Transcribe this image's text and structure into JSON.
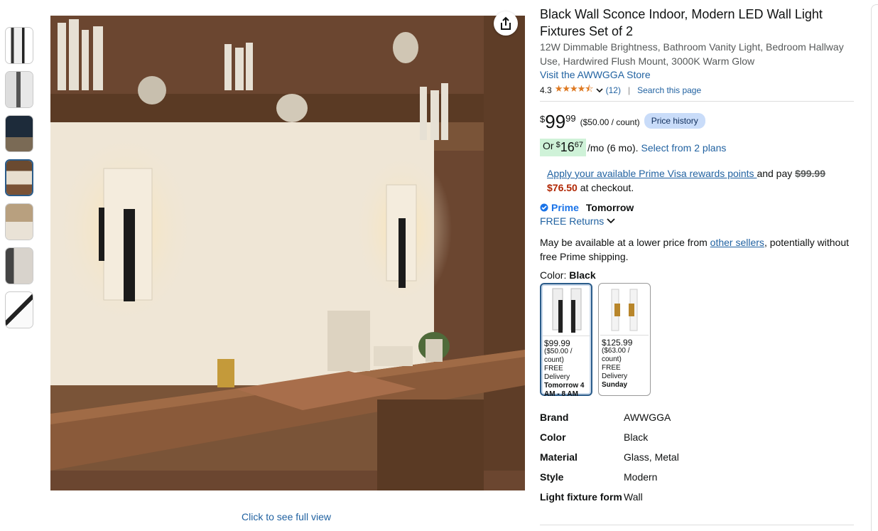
{
  "image": {
    "full_view_label": "Click to see full view"
  },
  "thumbnails": [
    {
      "name": "thumb-1"
    },
    {
      "name": "thumb-2"
    },
    {
      "name": "thumb-3"
    },
    {
      "name": "thumb-4"
    },
    {
      "name": "thumb-5"
    },
    {
      "name": "thumb-6"
    },
    {
      "name": "thumb-7"
    }
  ],
  "product": {
    "title": "Black Wall Sconce Indoor, Modern LED Wall Light Fixtures Set of 2",
    "subtitle": "12W Dimmable Brightness, Bathroom Vanity Light, Bedroom Hallway Use, Hardwired Flush Mount, 3000K Warm Glow",
    "store_link": "Visit the AWWGGA Store",
    "rating_value": "4.3",
    "stars": "★★★★⯪",
    "rating_count": "(12)",
    "search_page": "Search this page"
  },
  "price": {
    "symbol": "$",
    "whole": "99",
    "fraction": "99",
    "unit_price": "($50.00 / count)",
    "history_label": "Price history"
  },
  "monthly": {
    "prefix": "Or",
    "symbol": "$",
    "whole": "16",
    "fraction": "67",
    "suffix": "/mo (6 mo).",
    "plans_link": "Select from 2 plans"
  },
  "promo": {
    "link": "Apply your available Prime Visa rewards points ",
    "and_pay": "and pay",
    "old_price": "$99.99",
    "new_price": "$76.50",
    "checkout": "at checkout."
  },
  "delivery": {
    "prime_label": "Prime",
    "day": "Tomorrow",
    "returns": "FREE Returns"
  },
  "availability": {
    "text_1": "May be available at a lower price from ",
    "link": "other sellers",
    "text_2": ", potentially without free Prime shipping."
  },
  "color": {
    "label": "Color:",
    "value": "Black"
  },
  "swatches": [
    {
      "price": "$99.99",
      "unit": "($50.00 / count)",
      "delivery": "FREE Delivery",
      "when": "Tomorrow 4 AM - 8 AM",
      "selected": true
    },
    {
      "price": "$125.99",
      "unit": "($63.00 / count)",
      "delivery": "FREE Delivery",
      "when": "Sunday",
      "selected": false
    }
  ],
  "specs": [
    {
      "k": "Brand",
      "v": "AWWGGA"
    },
    {
      "k": "Color",
      "v": "Black"
    },
    {
      "k": "Material",
      "v": "Glass, Metal"
    },
    {
      "k": "Style",
      "v": "Modern"
    },
    {
      "k": "Light fixture form",
      "v": "Wall"
    }
  ],
  "colors": {
    "link": "#2162a1",
    "star": "#de7921",
    "price_red": "#b12704",
    "prime_blue": "#1a73e8",
    "selected_border": "#2b5c8a"
  }
}
